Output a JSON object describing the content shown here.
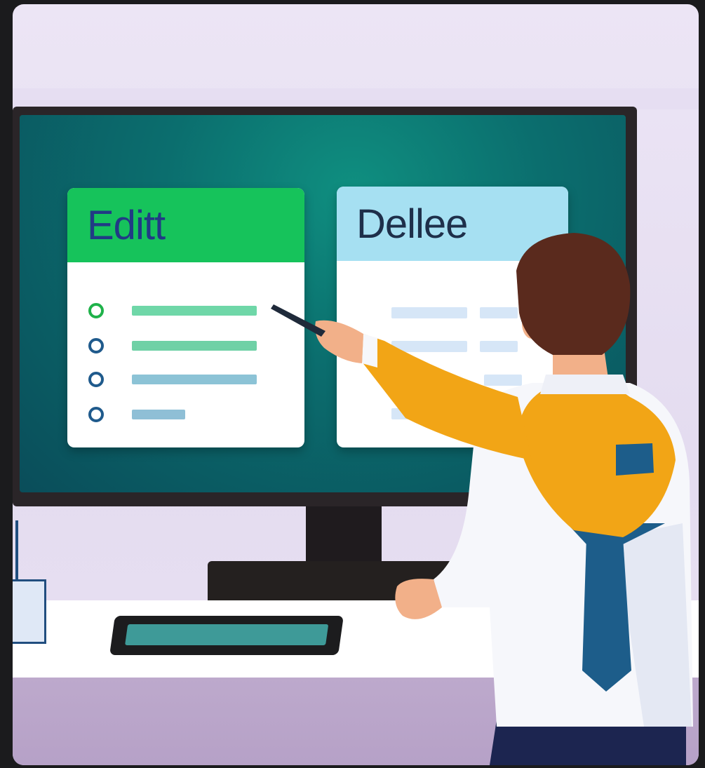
{
  "screen": {
    "edit_card": {
      "title": "Editt",
      "bar_colors": [
        "#6fd7a8",
        "#6fd1a6",
        "#8cc3d6",
        "#8fbfd6"
      ]
    },
    "delete_card": {
      "title": "Dellee"
    }
  },
  "colors": {
    "edit_header": "#16c35b",
    "delete_header": "#a6e0f2",
    "shirt": "#f6f7fb",
    "vest": "#f2a516",
    "tie": "#1d5d8a"
  }
}
